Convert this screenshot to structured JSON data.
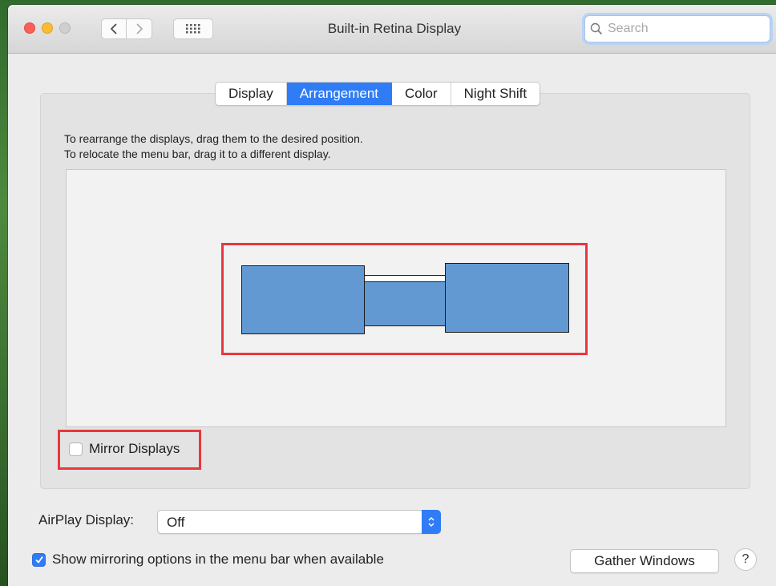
{
  "window": {
    "title": "Built-in Retina Display"
  },
  "toolbar": {
    "back_icon": "chevron-left-icon",
    "forward_icon": "chevron-right-icon",
    "grid_icon": "grid-icon"
  },
  "search": {
    "placeholder": "Search",
    "value": ""
  },
  "tabs": [
    {
      "label": "Display",
      "active": false
    },
    {
      "label": "Arrangement",
      "active": true
    },
    {
      "label": "Color",
      "active": false
    },
    {
      "label": "Night Shift",
      "active": false
    }
  ],
  "instructions": {
    "line1": "To rearrange the displays, drag them to the desired position.",
    "line2": "To relocate the menu bar, drag it to a different display."
  },
  "arrangement": {
    "display_count": 3,
    "highlight_color": "#e8373d",
    "display_color": "#6299d2"
  },
  "mirror": {
    "label": "Mirror Displays",
    "checked": false
  },
  "airplay": {
    "label": "AirPlay Display:",
    "value": "Off"
  },
  "show_mirroring": {
    "label": "Show mirroring options in the menu bar when available",
    "checked": true
  },
  "gather": {
    "label": "Gather Windows"
  },
  "help": {
    "label": "?"
  },
  "colors": {
    "accent": "#2f7cf6",
    "annotation_red": "#e8373d"
  }
}
